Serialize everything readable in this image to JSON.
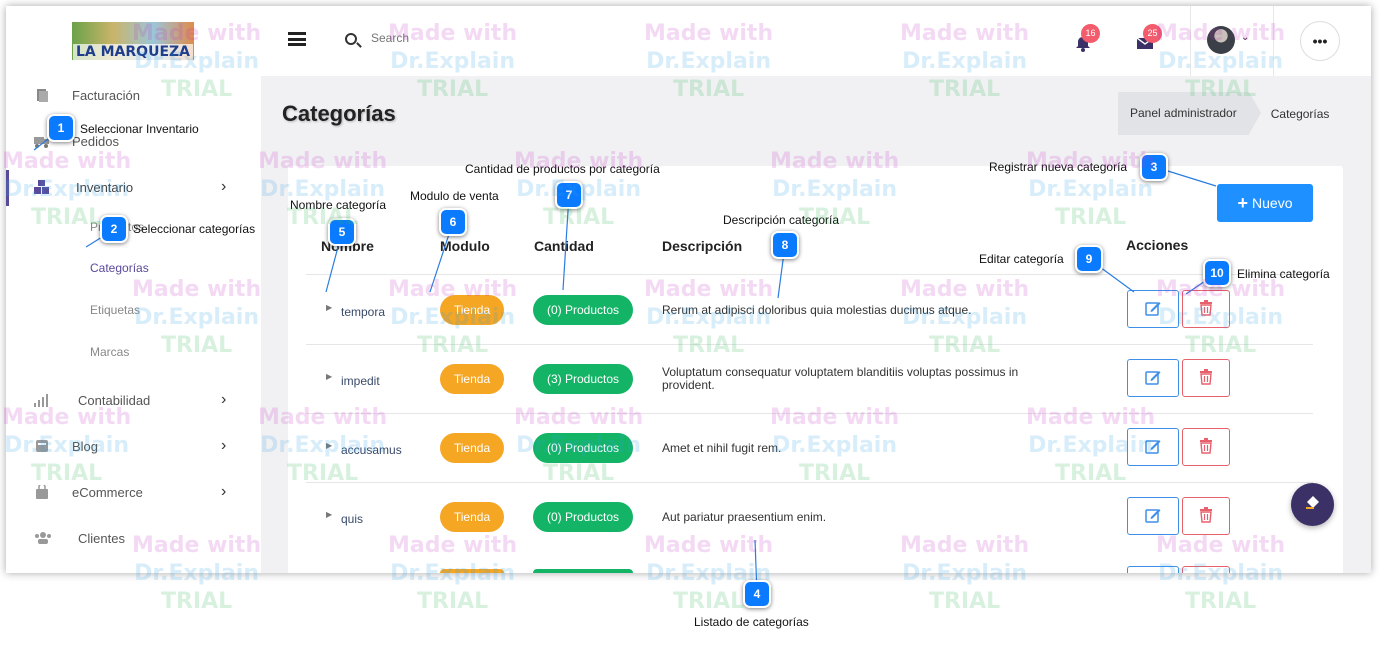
{
  "app": {
    "logo_text": "LA MARQUEZA"
  },
  "topbar": {
    "search_placeholder": "Search",
    "notifications_count": "16",
    "messages_count": "25",
    "more_label": "•••"
  },
  "sidebar": {
    "items": [
      {
        "label": "Facturación",
        "icon": "file-icon"
      },
      {
        "label": "Pedidos",
        "icon": "truck-icon"
      },
      {
        "label": "Inventario",
        "icon": "boxes-icon"
      },
      {
        "label": "Contabilidad",
        "icon": "bar-chart-icon"
      },
      {
        "label": "Blog",
        "icon": "blog-icon"
      },
      {
        "label": "eCommerce",
        "icon": "bag-icon"
      },
      {
        "label": "Clientes",
        "icon": "users-icon"
      }
    ],
    "subitems": [
      "Productos",
      "Categorías",
      "Etiquetas",
      "Marcas"
    ]
  },
  "page": {
    "title": "Categorías",
    "breadcrumb": [
      "Panel administrador",
      "Categorías"
    ],
    "new_button": "Nuevo"
  },
  "table": {
    "headers": [
      "Nombre",
      "Modulo",
      "Cantidad",
      "Descripción",
      "Acciones"
    ],
    "rows": [
      {
        "nombre": "tempora",
        "modulo": "Tienda",
        "cantidad": "(0) Productos",
        "descripcion": "Rerum at adipisci doloribus quia molestias ducimus atque."
      },
      {
        "nombre": "impedit",
        "modulo": "Tienda",
        "cantidad": "(3) Productos",
        "descripcion": "Voluptatum consequatur voluptatem blanditiis voluptas possimus in provident."
      },
      {
        "nombre": "accusamus",
        "modulo": "Tienda",
        "cantidad": "(0) Productos",
        "descripcion": "Amet et nihil fugit rem."
      },
      {
        "nombre": "quis",
        "modulo": "Tienda",
        "cantidad": "(0) Productos",
        "descripcion": "Aut pariatur praesentium enim."
      }
    ]
  },
  "annotations": [
    {
      "n": "1",
      "text": "Seleccionar Inventario"
    },
    {
      "n": "2",
      "text": "Seleccionar categorías"
    },
    {
      "n": "3",
      "text": "Registrar nueva categoría"
    },
    {
      "n": "4",
      "text": "Listado de categorías"
    },
    {
      "n": "5",
      "text": "Nombre categoría"
    },
    {
      "n": "6",
      "text": "Modulo de venta"
    },
    {
      "n": "7",
      "text": "Cantidad de productos por categoría"
    },
    {
      "n": "8",
      "text": "Descripción categoría"
    },
    {
      "n": "9",
      "text": "Editar categoría"
    },
    {
      "n": "10",
      "text": "Elimina categoría"
    }
  ],
  "watermark": {
    "line1": "Made with",
    "line2": "Dr.Explain",
    "line3": "TRIAL"
  },
  "colors": {
    "primary": "#1e90ff",
    "tienda": "#f5a623",
    "productos": "#14b466",
    "delete": "#e8606c",
    "badge": "#f25c6c",
    "marker": "#0a7bff"
  }
}
